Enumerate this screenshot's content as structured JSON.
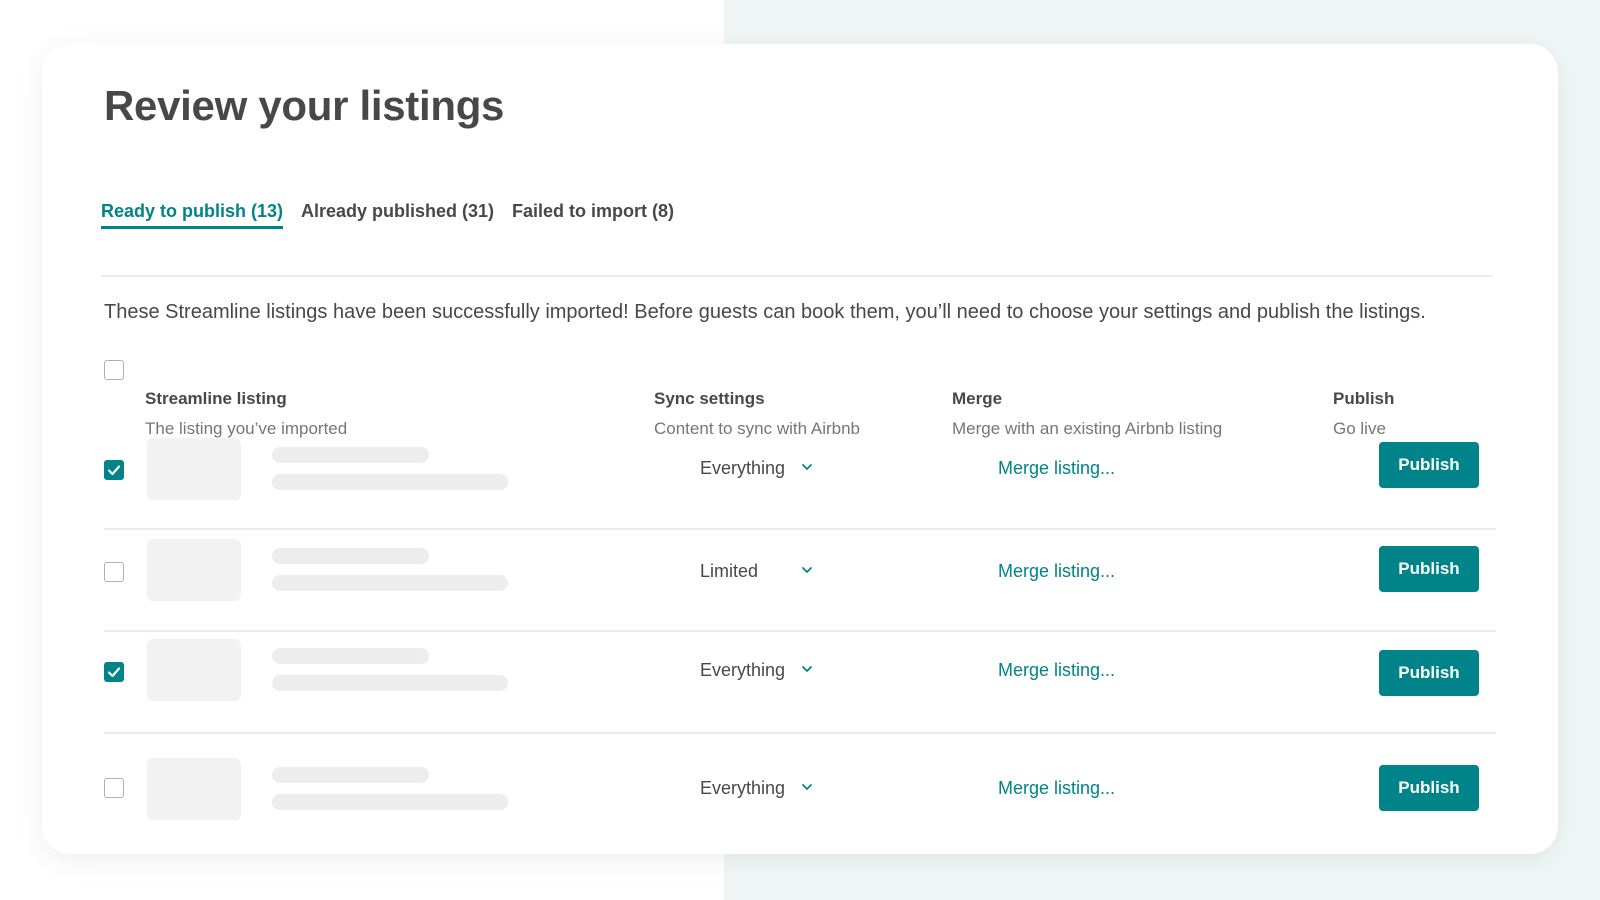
{
  "page": {
    "title": "Review your listings",
    "intro": "These Streamline listings have been successfully imported! Before guests can book them, you’ll need to choose your settings and publish the listings."
  },
  "tabs": [
    {
      "label": "Ready to publish (13)",
      "active": true
    },
    {
      "label": "Already published (31)",
      "active": false
    },
    {
      "label": "Failed to import (8)",
      "active": false
    }
  ],
  "columns": {
    "listing": {
      "title": "Streamline listing",
      "subtitle": "The listing you’ve imported"
    },
    "sync": {
      "title": "Sync settings",
      "subtitle": "Content to sync with Airbnb"
    },
    "merge": {
      "title": "Merge",
      "subtitle": "Merge with an existing Airbnb listing"
    },
    "publish": {
      "title": "Publish",
      "subtitle": "Go live"
    }
  },
  "select_all_checked": false,
  "rows": [
    {
      "checked": true,
      "sync": "Everything",
      "merge": "Merge listing...",
      "publish": "Publish"
    },
    {
      "checked": false,
      "sync": "Limited",
      "merge": "Merge listing...",
      "publish": "Publish"
    },
    {
      "checked": true,
      "sync": "Everything",
      "merge": "Merge listing...",
      "publish": "Publish"
    },
    {
      "checked": false,
      "sync": "Everything",
      "merge": "Merge listing...",
      "publish": "Publish"
    }
  ],
  "colors": {
    "accent": "#00848a",
    "text": "#484848",
    "muted": "#767676",
    "background_right": "#eff7f6"
  },
  "icons": {
    "checkbox_checked": "checkmark-icon",
    "dropdown": "chevron-down-icon"
  }
}
